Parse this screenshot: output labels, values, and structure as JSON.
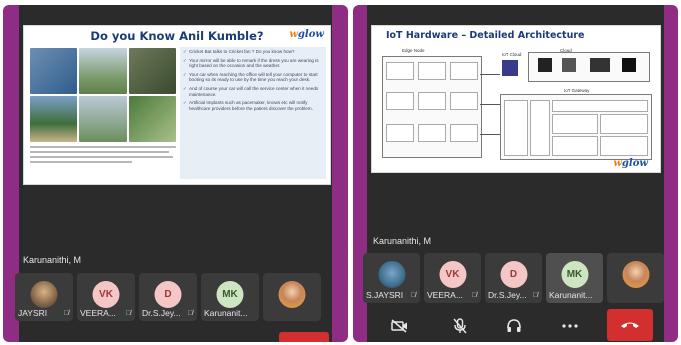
{
  "left_screen": {
    "slide": {
      "title": "Do you Know Anil Kumble?",
      "logo": "wglow",
      "bullets": [
        "Cricket Bat talks to Cricket fan ? Do you know how?",
        "Your mirror will be able to remark if the dress you are wearing is right based on the occasion and the weather.",
        "Your car when reaching the office will tell your computer to start booting so its ready to use by the time you reach your desk.",
        "And of course your car will call the service center when it needs maintenance.",
        "Artificial Implants such as pacemaker, knows etc will notify healthcare providers before the patient discover the problem."
      ]
    },
    "presenter_label": "Karunanithi, M",
    "participants": [
      {
        "name": "JAYSRI",
        "initials": "",
        "avatar": "photo",
        "muted": true
      },
      {
        "name": "VEERA...",
        "initials": "VK",
        "avatar_color": "#f4c6c6",
        "muted": true
      },
      {
        "name": "Dr.S.Jey...",
        "initials": "D",
        "avatar_color": "#f4c6c6",
        "muted": true
      },
      {
        "name": "Karunanit...",
        "initials": "MK",
        "avatar_color": "#cde5c2",
        "muted": false
      },
      {
        "name": "",
        "initials": "",
        "avatar": "photo2",
        "muted": false
      }
    ]
  },
  "right_screen": {
    "slide": {
      "title": "IoT Hardware – Detailed Architecture",
      "logo": "wglow",
      "labels": {
        "edge_node": "Edge Node",
        "iot_cloud": "IoT Cloud",
        "cloud": "Cloud",
        "iot_gateway": "IoT Gateway"
      }
    },
    "presenter_label": "Karunanithi, M",
    "participants": [
      {
        "name": "S.JAYSRI",
        "initials": "",
        "avatar": "photo1",
        "muted": true
      },
      {
        "name": "VEERA...",
        "initials": "VK",
        "avatar_color": "#f4c6c6",
        "muted": true
      },
      {
        "name": "Dr.S.Jey...",
        "initials": "D",
        "avatar_color": "#f4c6c6",
        "muted": true
      },
      {
        "name": "Karunanit...",
        "initials": "MK",
        "avatar_color": "#cde5c2",
        "muted": false,
        "active": true
      },
      {
        "name": "",
        "initials": "",
        "avatar": "photo2",
        "muted": false
      }
    ],
    "controls": [
      "camera-off-icon",
      "mic-off-icon",
      "headset-icon",
      "more-icon",
      "end-call-icon"
    ]
  },
  "colors": {
    "frame_purple": "#8e2d83",
    "app_dark": "#2b2b2b",
    "tile": "#3b3b3b",
    "end_call": "#d32f2f",
    "slide_title": "#1b3b7a"
  }
}
